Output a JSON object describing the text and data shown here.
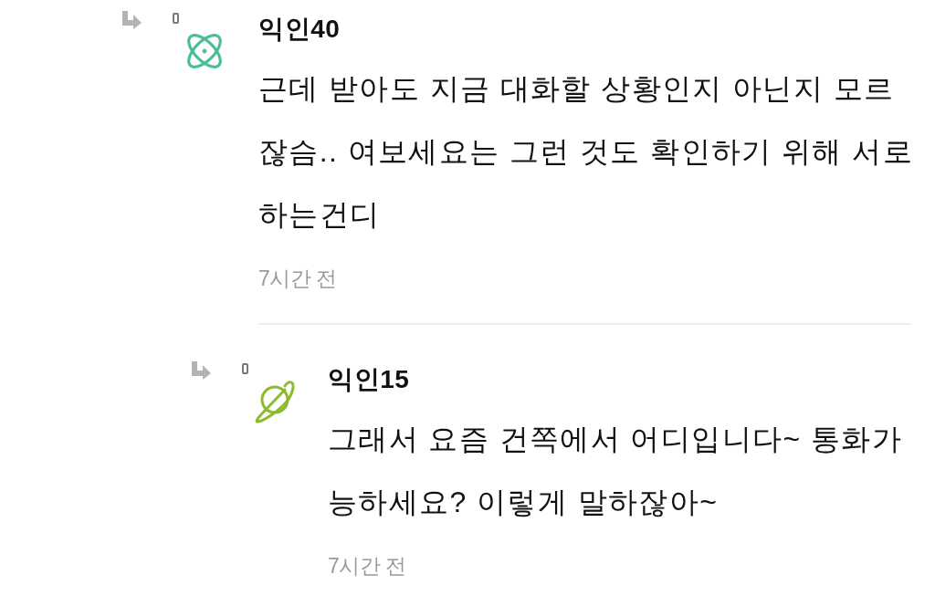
{
  "comments": [
    {
      "author": "익인40",
      "avatar": {
        "kind": "atom",
        "color": "#4bbf93"
      },
      "body": "근데 받아도 지금 대화할 상황인지 아닌지 모르잖슴.. 여보세요는 그런 것도 확인하기 위해 서로 하는건디",
      "time": "7시간 전",
      "children": [
        {
          "author": "익인15",
          "avatar": {
            "kind": "planet",
            "color": "#8dbb2c"
          },
          "body": "그래서 요즘 건쪽에서 어디입니다~ 통화가 능하세요? 이렇게 말하잖아~",
          "time": "7시간 전"
        }
      ]
    }
  ]
}
